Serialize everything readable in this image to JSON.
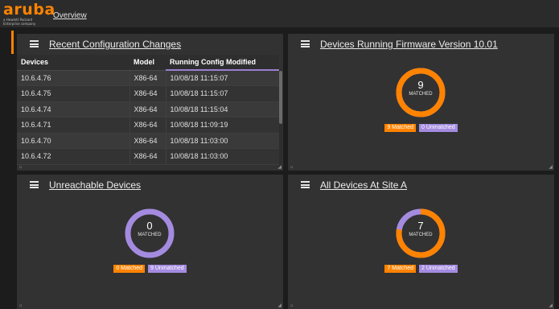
{
  "header": {
    "logo_text": "aruba",
    "logo_tagline": "a Hewlett Packard Enterprise company",
    "breadcrumb": "Overview"
  },
  "colors": {
    "accent_orange": "#ff8300",
    "purple": "#a48be0"
  },
  "panels": {
    "recent_changes": {
      "title": "Recent Configuration Changes",
      "columns": [
        "Devices",
        "Model",
        "Running Config Modified"
      ],
      "rows": [
        [
          "10.6.4.76",
          "X86-64",
          "10/08/18 11:15:07"
        ],
        [
          "10.6.4.75",
          "X86-64",
          "10/08/18 11:15:07"
        ],
        [
          "10.6.4.74",
          "X86-64",
          "10/08/18 11:15:04"
        ],
        [
          "10.6.4.71",
          "X86-64",
          "10/08/18 11:09:19"
        ],
        [
          "10.6.4.70",
          "X86-64",
          "10/08/18 11:03:00"
        ],
        [
          "10.6.4.72",
          "X86-64",
          "10/08/18 11:03:00"
        ]
      ]
    },
    "firmware": {
      "title": "Devices Running Firmware Version 10.01",
      "count": "9",
      "count_label": "MATCHED",
      "matched": 9,
      "unmatched": 0,
      "matched_label": "9 Matched",
      "unmatched_label": "0 Unmatched"
    },
    "unreachable": {
      "title": "Unreachable Devices",
      "count": "0",
      "count_label": "MATCHED",
      "matched": 0,
      "unmatched": 9,
      "matched_label": "0 Matched",
      "unmatched_label": "9 Unmatched"
    },
    "site_a": {
      "title": "All Devices At Site A",
      "count": "7",
      "count_label": "MATCHED",
      "matched": 7,
      "unmatched": 2,
      "matched_label": "7 Matched",
      "unmatched_label": "2 Unmatched"
    }
  }
}
